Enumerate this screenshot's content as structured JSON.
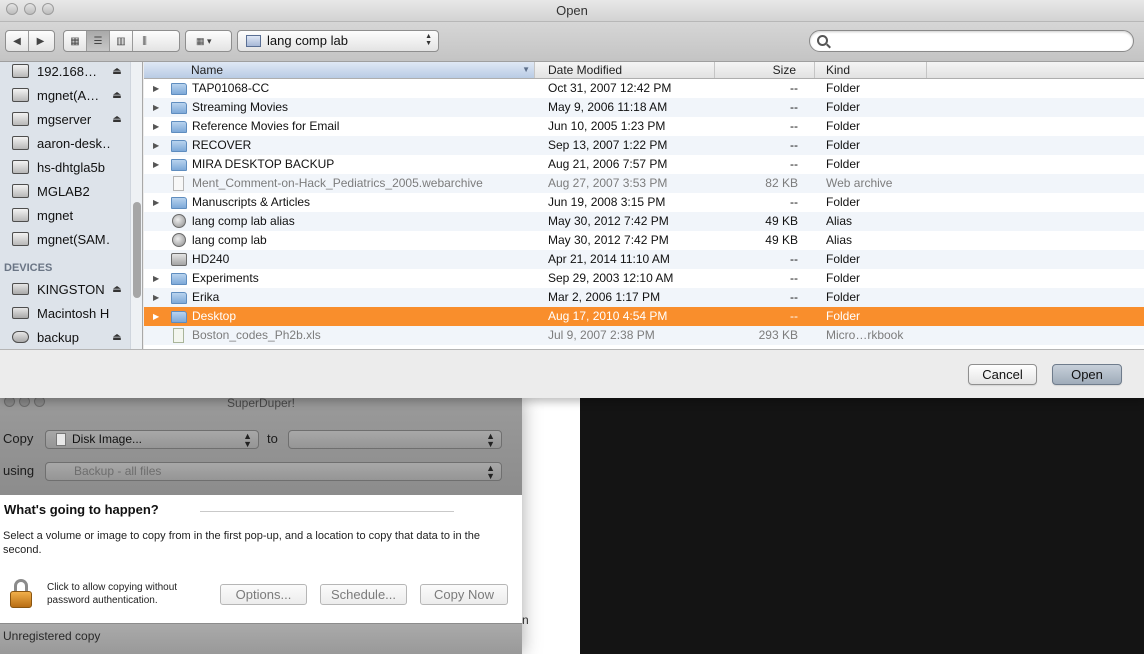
{
  "window": {
    "title": "Open"
  },
  "toolbar": {
    "location": "lang comp lab",
    "search_value": "",
    "view_mode": "list"
  },
  "sidebar": {
    "shared_items": [
      {
        "label": "192.168…",
        "eject": true
      },
      {
        "label": "mgnet(A…",
        "eject": true
      },
      {
        "label": "mgserver",
        "eject": true
      },
      {
        "label": "aaron-desk…",
        "eject": false
      },
      {
        "label": "hs-dhtgla5b",
        "eject": false
      },
      {
        "label": "MGLAB2",
        "eject": false
      },
      {
        "label": "mgnet",
        "eject": false
      },
      {
        "label": "mgnet(SAM…",
        "eject": false
      }
    ],
    "devices_header": "DEVICES",
    "devices": [
      {
        "label": "KINGSTON",
        "eject": true
      },
      {
        "label": "Macintosh HD",
        "eject": false
      },
      {
        "label": "backup",
        "eject": true
      }
    ]
  },
  "file_list": {
    "columns": {
      "name": "Name",
      "date": "Date Modified",
      "size": "Size",
      "kind": "Kind"
    },
    "rows": [
      {
        "name": "TAP01068-CC",
        "date": "Oct 31, 2007 12:42 PM",
        "size": "--",
        "kind": "Folder",
        "icon": "folder-icon",
        "expandable": true,
        "selected": false,
        "dimmed": false
      },
      {
        "name": "Streaming Movies",
        "date": "May 9, 2006 11:18 AM",
        "size": "--",
        "kind": "Folder",
        "icon": "folder-icon",
        "expandable": true,
        "selected": false,
        "dimmed": false
      },
      {
        "name": "Reference Movies for Email",
        "date": "Jun 10, 2005 1:23 PM",
        "size": "--",
        "kind": "Folder",
        "icon": "folder-icon",
        "expandable": true,
        "selected": false,
        "dimmed": false
      },
      {
        "name": "RECOVER",
        "date": "Sep 13, 2007 1:22 PM",
        "size": "--",
        "kind": "Folder",
        "icon": "folder-icon",
        "expandable": true,
        "selected": false,
        "dimmed": false
      },
      {
        "name": "MIRA DESKTOP BACKUP",
        "date": "Aug 21, 2006 7:57 PM",
        "size": "--",
        "kind": "Folder",
        "icon": "folder-icon",
        "expandable": true,
        "selected": false,
        "dimmed": false
      },
      {
        "name": "Ment_Comment-on-Hack_Pediatrics_2005.webarchive",
        "date": "Aug 27, 2007 3:53 PM",
        "size": "82 KB",
        "kind": "Web archive",
        "icon": "webarchive-icon",
        "expandable": false,
        "selected": false,
        "dimmed": true
      },
      {
        "name": "Manuscripts & Articles",
        "date": "Jun 19, 2008 3:15 PM",
        "size": "--",
        "kind": "Folder",
        "icon": "folder-icon",
        "expandable": true,
        "selected": false,
        "dimmed": false
      },
      {
        "name": "lang comp lab alias",
        "date": "May 30, 2012 7:42 PM",
        "size": "49 KB",
        "kind": "Alias",
        "icon": "alias-icon",
        "expandable": false,
        "selected": false,
        "dimmed": false
      },
      {
        "name": "lang comp lab",
        "date": "May 30, 2012 7:42 PM",
        "size": "49 KB",
        "kind": "Alias",
        "icon": "alias-icon",
        "expandable": false,
        "selected": false,
        "dimmed": false
      },
      {
        "name": "HD240",
        "date": "Apr 21, 2014 11:10 AM",
        "size": "--",
        "kind": "Folder",
        "icon": "drive-icon",
        "expandable": false,
        "selected": false,
        "dimmed": false
      },
      {
        "name": "Experiments",
        "date": "Sep 29, 2003 12:10 AM",
        "size": "--",
        "kind": "Folder",
        "icon": "folder-icon",
        "expandable": true,
        "selected": false,
        "dimmed": false
      },
      {
        "name": "Erika",
        "date": "Mar 2, 2006 1:17 PM",
        "size": "--",
        "kind": "Folder",
        "icon": "folder-icon",
        "expandable": true,
        "selected": false,
        "dimmed": false
      },
      {
        "name": "Desktop",
        "date": "Aug 17, 2010 4:54 PM",
        "size": "--",
        "kind": "Folder",
        "icon": "folder-icon",
        "expandable": true,
        "selected": true,
        "dimmed": false
      },
      {
        "name": "Boston_codes_Ph2b.xls",
        "date": "Jul 9, 2007 2:38 PM",
        "size": "293 KB",
        "kind": "Micro…rkbook",
        "icon": "spreadsheet-icon",
        "expandable": false,
        "selected": false,
        "dimmed": true
      }
    ]
  },
  "buttons": {
    "cancel": "Cancel",
    "open": "Open"
  },
  "background_window": {
    "title": "SuperDuper!",
    "copy_label": "Copy",
    "copy_value": "Disk Image...",
    "to_label": "to",
    "to_value": "",
    "using_label": "using",
    "using_value": "Backup - all files",
    "heading": "What's going to happen?",
    "description": "Select a volume or image to copy from in the first pop-up, and a location to copy that data to in the second.",
    "lock_text": "Click to allow copying without password authentication.",
    "options_button": "Options...",
    "schedule_button": "Schedule...",
    "copy_now_button": "Copy Now",
    "status": "Unregistered copy",
    "fragment": "n"
  },
  "colors": {
    "selection": "#f98e2c",
    "sidebar_bg": "#dde3ea",
    "folder_blue": "#7ea9d8",
    "default_button": "#9fabb9"
  }
}
